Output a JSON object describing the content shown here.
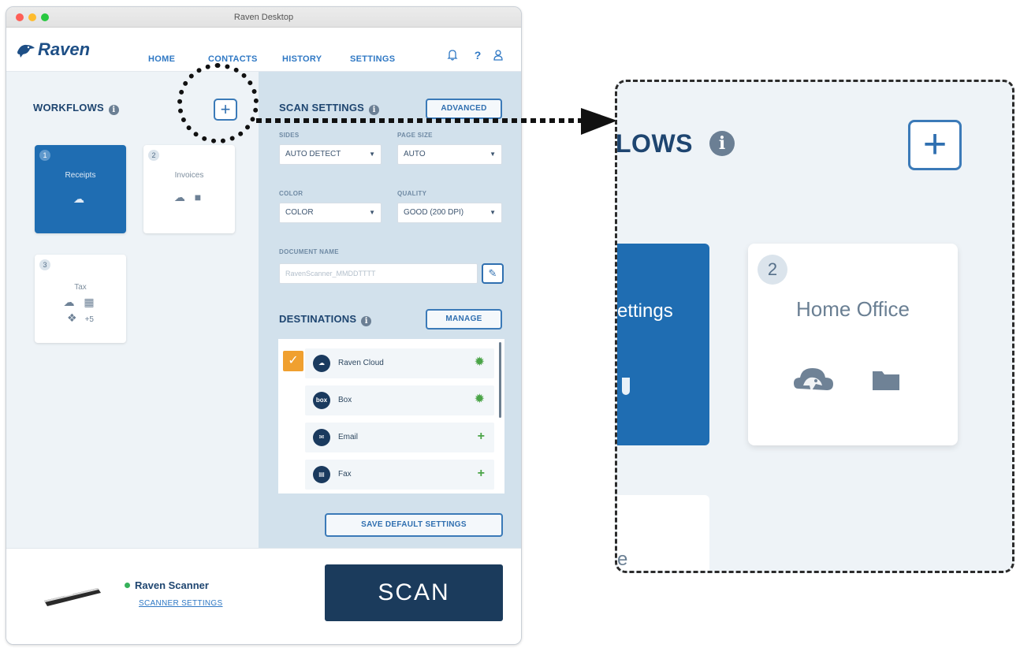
{
  "window": {
    "title": "Raven Desktop"
  },
  "brand": {
    "name": "Raven"
  },
  "nav": {
    "links": [
      "HOME",
      "CONTACTS",
      "HISTORY",
      "SETTINGS"
    ],
    "icons": [
      "bell-icon",
      "help-icon",
      "user-icon"
    ]
  },
  "workflows": {
    "title": "WORKFLOWS",
    "add_label": "+",
    "items": [
      {
        "number": "1",
        "name": "Receipts",
        "icons": [
          "raven-cloud-icon"
        ],
        "active": true
      },
      {
        "number": "2",
        "name": "Invoices",
        "icons": [
          "raven-cloud-icon",
          "folder-icon"
        ],
        "active": false
      },
      {
        "number": "3",
        "name": "Tax",
        "icons": [
          "raven-cloud-icon",
          "grid-icon",
          "dropbox-icon"
        ],
        "extra": "+5",
        "active": false
      }
    ]
  },
  "scan_settings": {
    "title": "SCAN SETTINGS",
    "advanced_label": "ADVANCED",
    "sides": {
      "label": "SIDES",
      "value": "AUTO DETECT"
    },
    "page_size": {
      "label": "PAGE SIZE",
      "value": "AUTO"
    },
    "color": {
      "label": "COLOR",
      "value": "COLOR"
    },
    "quality": {
      "label": "QUALITY",
      "value": "GOOD (200 DPI)"
    },
    "document_name": {
      "label": "DOCUMENT NAME",
      "placeholder": "RavenScanner_MMDDTTTT"
    }
  },
  "destinations": {
    "title": "DESTINATIONS",
    "manage_label": "MANAGE",
    "items": [
      {
        "name": "Raven Cloud",
        "icon_text": "",
        "action": "gear",
        "checked": true
      },
      {
        "name": "Box",
        "icon_text": "box",
        "action": "gear",
        "checked": false
      },
      {
        "name": "Email",
        "icon_text": "",
        "action": "add",
        "checked": false
      },
      {
        "name": "Fax",
        "icon_text": "",
        "action": "add",
        "checked": false
      }
    ],
    "save_default_label": "SAVE DEFAULT SETTINGS"
  },
  "scanner": {
    "name": "Raven Scanner",
    "settings_label": "SCANNER SETTINGS",
    "status_color": "#36b15a"
  },
  "scan_button": {
    "label": "SCAN"
  },
  "zoom": {
    "title_fragment": "LOWS",
    "active_card_fragment": "ettings",
    "card": {
      "number": "2",
      "name": "Home Office"
    },
    "bottom_fragment": "e"
  },
  "colors": {
    "primary": "#1f6db2",
    "navy": "#1b3b5c",
    "accent_orange": "#f0a02f",
    "accent_green": "#4aa447",
    "link_blue": "#2f78c4"
  }
}
